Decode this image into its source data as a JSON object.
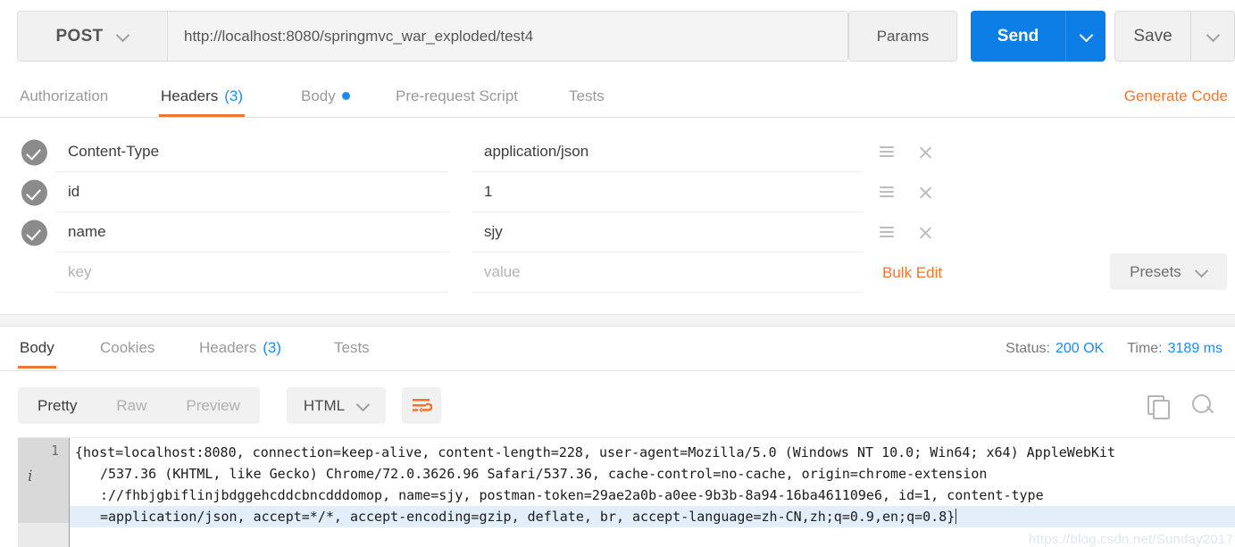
{
  "request": {
    "method": "POST",
    "url": "http://localhost:8080/springmvc_war_exploded/test4",
    "params_label": "Params",
    "send_label": "Send",
    "save_label": "Save"
  },
  "request_tabs": {
    "items": [
      {
        "label": "Authorization",
        "count": "",
        "active": false,
        "dot": false
      },
      {
        "label": "Headers",
        "count": "(3)",
        "active": true,
        "dot": false
      },
      {
        "label": "Body",
        "count": "",
        "active": false,
        "dot": true
      },
      {
        "label": "Pre-request Script",
        "count": "",
        "active": false,
        "dot": false
      },
      {
        "label": "Tests",
        "count": "",
        "active": false,
        "dot": false
      }
    ],
    "generate_code": "Generate Code"
  },
  "headers_table": {
    "rows": [
      {
        "key": "Content-Type",
        "value": "application/json",
        "checked": true,
        "placeholder": false
      },
      {
        "key": "id",
        "value": "1",
        "checked": true,
        "placeholder": false
      },
      {
        "key": "name",
        "value": "sjy",
        "checked": true,
        "placeholder": false
      },
      {
        "key": "key",
        "value": "value",
        "checked": false,
        "placeholder": true
      }
    ],
    "bulk_edit": "Bulk Edit",
    "presets": "Presets"
  },
  "response_tabs": {
    "items": [
      {
        "label": "Body",
        "count": "",
        "active": true
      },
      {
        "label": "Cookies",
        "count": "",
        "active": false
      },
      {
        "label": "Headers",
        "count": "(3)",
        "active": false
      },
      {
        "label": "Tests",
        "count": "",
        "active": false
      }
    ],
    "status_label": "Status:",
    "status_value": "200 OK",
    "time_label": "Time:",
    "time_value": "3189 ms"
  },
  "response_toolbar": {
    "view_modes": [
      {
        "label": "Pretty",
        "active": true
      },
      {
        "label": "Raw",
        "active": false
      },
      {
        "label": "Preview",
        "active": false
      }
    ],
    "format": "HTML",
    "wrap_icon": "word-wrap-icon",
    "copy_icon": "copy-icon",
    "search_icon": "search-icon"
  },
  "code_viewer": {
    "line_number": "1",
    "fold_glyph": "i",
    "lines": [
      {
        "text": "{host=localhost:8080, connection=keep-alive, content-length=228, user-agent=Mozilla/5.0 (Windows NT 10.0; Win64; x64) AppleWebKit",
        "indent": false,
        "highlight": false
      },
      {
        "text": "/537.36 (KHTML, like Gecko) Chrome/72.0.3626.96 Safari/537.36, cache-control=no-cache, origin=chrome-extension",
        "indent": true,
        "highlight": false
      },
      {
        "text": "://fhbjgbiflinjbdggehcddcbncdddomop, name=sjy, postman-token=29ae2a0b-a0ee-9b3b-8a94-16ba461109e6, id=1, content-type",
        "indent": true,
        "highlight": false
      },
      {
        "text": "=application/json, accept=*/*, accept-encoding=gzip, deflate, br, accept-language=zh-CN,zh;q=0.9,en;q=0.8}",
        "indent": true,
        "highlight": true
      }
    ],
    "watermark": "https://blog.csdn.net/Sunday2017"
  },
  "colors": {
    "accent_orange": "#f2762e",
    "accent_blue": "#0d7ee6",
    "link_blue": "#1a8cff"
  }
}
